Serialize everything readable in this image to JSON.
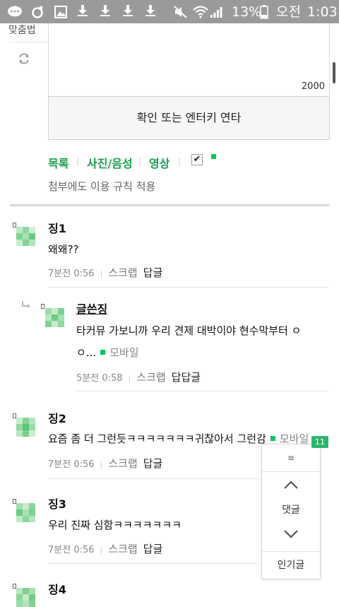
{
  "status_bar": {
    "battery_percent": "13%",
    "time_period": "오전",
    "time": "1:03"
  },
  "editor": {
    "spell_check_label": "맞춤법",
    "char_limit": "2000",
    "submit_label": "확인 또는 엔터키 연타",
    "attach_links": [
      "목록",
      "사진/음성",
      "영상"
    ],
    "notice": "첨부에도 이용 규칙 적용"
  },
  "comments": [
    {
      "nick": "징1",
      "body": "왜왜??",
      "time": "7분전 0:56",
      "scrap": "스크랩",
      "reply": "답글"
    },
    {
      "nick": "글쓴징",
      "body_line1": "타커뮤 가보니까 우리 견제 대박이야 현수막부터 ㅇ",
      "body_line2": "ㅇ...",
      "mobile": "모바일",
      "time": "5분전 0:58",
      "scrap": "스크랩",
      "reply": "답답글"
    },
    {
      "nick": "징2",
      "body": "요즘 좀 더 그런듯ㅋㅋㅋㅋㅋㅋㅋ귀찮아서 그런감",
      "mobile": "모바일",
      "time": "7분전 0:56",
      "scrap": "스크랩",
      "reply": "답글"
    },
    {
      "nick": "징3",
      "body": "우리 진짜 심함ㅋㅋㅋㅋㅋㅋㅋ",
      "time": "7분전 0:56",
      "scrap": "스크랩",
      "reply": "답글"
    },
    {
      "nick": "징4"
    }
  ],
  "float_nav": {
    "badge": "11",
    "menu_icon": "≡",
    "label": "댓글",
    "popular": "인기글"
  },
  "colors": {
    "status_bar": "#9a9a9a",
    "accent_green": "#03c75a",
    "link_green": "#1a9e4b"
  }
}
